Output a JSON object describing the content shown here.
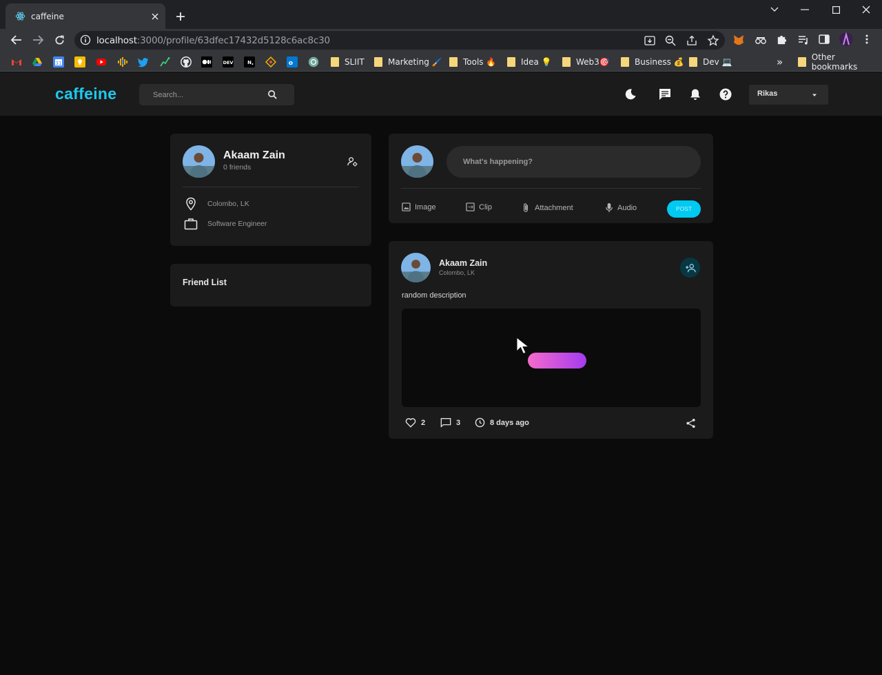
{
  "browser": {
    "tab_title": "caffeine",
    "url_host": "localhost",
    "url_rest": ":3000/profile/63dfec17432d5128c6ac8c30",
    "bookmarks": [
      {
        "label": "SLIIT",
        "emoji": ""
      },
      {
        "label": "Marketing",
        "emoji": "🖌️"
      },
      {
        "label": "Tools",
        "emoji": "🔥"
      },
      {
        "label": "Idea",
        "emoji": "💡"
      },
      {
        "label": "Web3",
        "emoji": "🎯"
      },
      {
        "label": "Business",
        "emoji": "💰"
      },
      {
        "label": "Dev",
        "emoji": "💻"
      }
    ],
    "other_bookmarks": "Other bookmarks",
    "overflow": "»"
  },
  "app": {
    "logo": "caffeine",
    "search_placeholder": "Search...",
    "user_select": "Rikas"
  },
  "profile": {
    "name": "Akaam Zain",
    "friends": "0 friends",
    "location": "Colombo, LK",
    "occupation": "Software Engineer"
  },
  "friend_list": {
    "title": "Friend List"
  },
  "composer": {
    "placeholder": "What's happening?",
    "options": [
      "Image",
      "Clip",
      "Attachment",
      "Audio"
    ],
    "post_label": "POST"
  },
  "post": {
    "author": "Akaam Zain",
    "location": "Colombo, LK",
    "description": "random description",
    "likes": "2",
    "comments": "3",
    "time": "8 days ago"
  },
  "colors": {
    "accent": "#00c9f2",
    "logo": "#1ec8ef",
    "background": "#0b0b0b",
    "card": "#1b1b1b"
  }
}
